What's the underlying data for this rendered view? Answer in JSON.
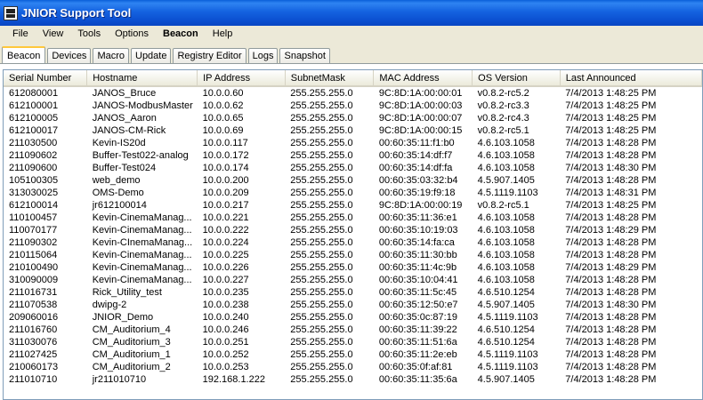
{
  "window": {
    "title": "JNIOR Support Tool"
  },
  "menu": [
    "File",
    "View",
    "Tools",
    "Options",
    "Beacon",
    "Help"
  ],
  "tabs": [
    "Beacon",
    "Devices",
    "Macro",
    "Update",
    "Registry Editor",
    "Logs",
    "Snapshot"
  ],
  "active_tab": "Beacon",
  "table": {
    "columns": [
      "Serial Number",
      "Hostname",
      "IP Address",
      "SubnetMask",
      "MAC Address",
      "OS Version",
      "Last Announced"
    ],
    "rows": [
      [
        "612080001",
        "JANOS_Bruce",
        "10.0.0.60",
        "255.255.255.0",
        "9C:8D:1A:00:00:01",
        "v0.8.2-rc5.2",
        "7/4/2013 1:48:25 PM"
      ],
      [
        "612100001",
        "JANOS-ModbusMaster",
        "10.0.0.62",
        "255.255.255.0",
        "9C:8D:1A:00:00:03",
        "v0.8.2-rc3.3",
        "7/4/2013 1:48:25 PM"
      ],
      [
        "612100005",
        "JANOS_Aaron",
        "10.0.0.65",
        "255.255.255.0",
        "9C:8D:1A:00:00:07",
        "v0.8.2-rc4.3",
        "7/4/2013 1:48:25 PM"
      ],
      [
        "612100017",
        "JANOS-CM-Rick",
        "10.0.0.69",
        "255.255.255.0",
        "9C:8D:1A:00:00:15",
        "v0.8.2-rc5.1",
        "7/4/2013 1:48:25 PM"
      ],
      [
        "211030500",
        "Kevin-IS20d",
        "10.0.0.117",
        "255.255.255.0",
        "00:60:35:11:f1:b0",
        "4.6.103.1058",
        "7/4/2013 1:48:28 PM"
      ],
      [
        "211090602",
        "Buffer-Test022-analog",
        "10.0.0.172",
        "255.255.255.0",
        "00:60:35:14:df:f7",
        "4.6.103.1058",
        "7/4/2013 1:48:28 PM"
      ],
      [
        "211090600",
        "Buffer-Test024",
        "10.0.0.174",
        "255.255.255.0",
        "00:60:35:14:df:fa",
        "4.6.103.1058",
        "7/4/2013 1:48:30 PM"
      ],
      [
        "105100305",
        "web_demo",
        "10.0.0.200",
        "255.255.255.0",
        "00:60:35:03:32:b4",
        "4.5.907.1405",
        "7/4/2013 1:48:28 PM"
      ],
      [
        "313030025",
        "OMS-Demo",
        "10.0.0.209",
        "255.255.255.0",
        "00:60:35:19:f9:18",
        "4.5.1119.1103",
        "7/4/2013 1:48:31 PM"
      ],
      [
        "612100014",
        "jr612100014",
        "10.0.0.217",
        "255.255.255.0",
        "9C:8D:1A:00:00:19",
        "v0.8.2-rc5.1",
        "7/4/2013 1:48:25 PM"
      ],
      [
        "110100457",
        "Kevin-CinemaManag...",
        "10.0.0.221",
        "255.255.255.0",
        "00:60:35:11:36:e1",
        "4.6.103.1058",
        "7/4/2013 1:48:28 PM"
      ],
      [
        "110070177",
        "Kevin-CinemaManag...",
        "10.0.0.222",
        "255.255.255.0",
        "00:60:35:10:19:03",
        "4.6.103.1058",
        "7/4/2013 1:48:29 PM"
      ],
      [
        "211090302",
        "Kevin-CInemaManag...",
        "10.0.0.224",
        "255.255.255.0",
        "00:60:35:14:fa:ca",
        "4.6.103.1058",
        "7/4/2013 1:48:28 PM"
      ],
      [
        "210115064",
        "Kevin-CinemaManag...",
        "10.0.0.225",
        "255.255.255.0",
        "00:60:35:11:30:bb",
        "4.6.103.1058",
        "7/4/2013 1:48:28 PM"
      ],
      [
        "210100490",
        "Kevin-CinemaManag...",
        "10.0.0.226",
        "255.255.255.0",
        "00:60:35:11:4c:9b",
        "4.6.103.1058",
        "7/4/2013 1:48:29 PM"
      ],
      [
        "310090009",
        "Kevin-CinemaManag...",
        "10.0.0.227",
        "255.255.255.0",
        "00:60:35:10:04:41",
        "4.6.103.1058",
        "7/4/2013 1:48:28 PM"
      ],
      [
        "211016731",
        "Rick_Utility_test",
        "10.0.0.235",
        "255.255.255.0",
        "00:60:35:11:5c:45",
        "4.6.510.1254",
        "7/4/2013 1:48:28 PM"
      ],
      [
        "211070538",
        "dwipg-2",
        "10.0.0.238",
        "255.255.255.0",
        "00:60:35:12:50:e7",
        "4.5.907.1405",
        "7/4/2013 1:48:30 PM"
      ],
      [
        "209060016",
        "JNIOR_Demo",
        "10.0.0.240",
        "255.255.255.0",
        "00:60:35:0c:87:19",
        "4.5.1119.1103",
        "7/4/2013 1:48:28 PM"
      ],
      [
        "211016760",
        "CM_Auditorium_4",
        "10.0.0.246",
        "255.255.255.0",
        "00:60:35:11:39:22",
        "4.6.510.1254",
        "7/4/2013 1:48:28 PM"
      ],
      [
        "311030076",
        "CM_Auditorium_3",
        "10.0.0.251",
        "255.255.255.0",
        "00:60:35:11:51:6a",
        "4.6.510.1254",
        "7/4/2013 1:48:28 PM"
      ],
      [
        "211027425",
        "CM_Auditorium_1",
        "10.0.0.252",
        "255.255.255.0",
        "00:60:35:11:2e:eb",
        "4.5.1119.1103",
        "7/4/2013 1:48:28 PM"
      ],
      [
        "210060173",
        "CM_Auditorium_2",
        "10.0.0.253",
        "255.255.255.0",
        "00:60:35:0f:af:81",
        "4.5.1119.1103",
        "7/4/2013 1:48:28 PM"
      ],
      [
        "211010710",
        "jr211010710",
        "192.168.1.222",
        "255.255.255.0",
        "00:60:35:11:35:6a",
        "4.5.907.1405",
        "7/4/2013 1:48:28 PM"
      ]
    ]
  }
}
